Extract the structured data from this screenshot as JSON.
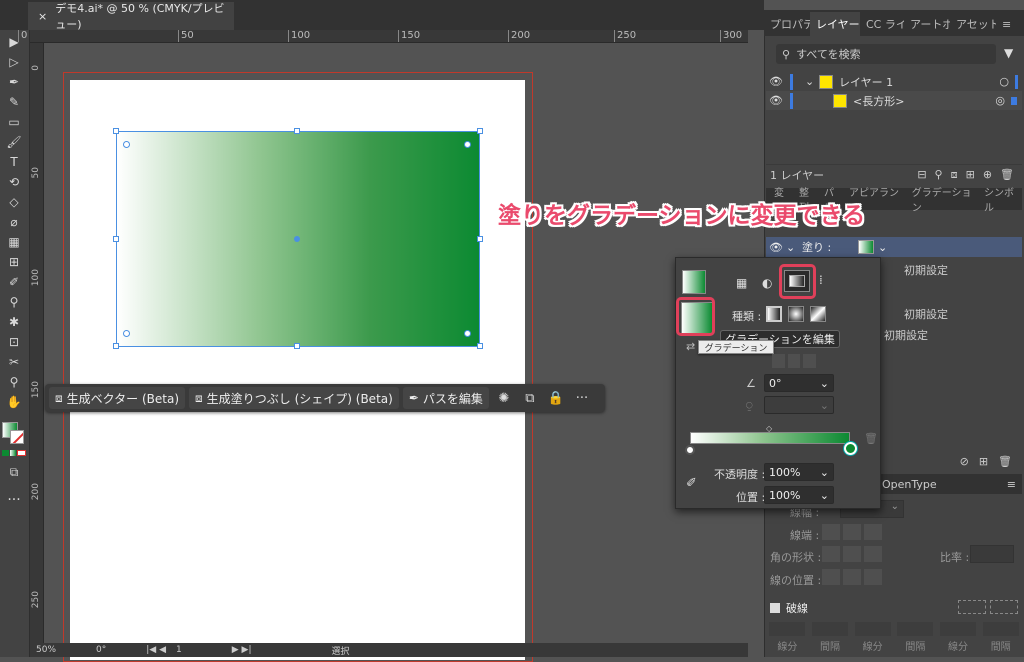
{
  "document": {
    "tab_title": "デモ4.ai* @ 50 % (CMYK/プレビュー)",
    "close_glyph": "×"
  },
  "ruler": {
    "h_ticks": [
      "0",
      "50",
      "100",
      "150",
      "200",
      "250",
      "300"
    ],
    "v_ticks": [
      "0",
      "50",
      "100",
      "150",
      "200",
      "250"
    ]
  },
  "context_bar": {
    "gen_vector": "生成ベクター (Beta)",
    "gen_fill": "生成塗りつぶし (シェイプ) (Beta)",
    "edit_path": "パスを編集"
  },
  "status_bar": {
    "zoom": "50%",
    "rotation": "0°",
    "artboard": "1",
    "tool": "選択"
  },
  "panel_tabs": [
    "プロパティ",
    "レイヤー",
    "CC ライブラリ",
    "アートボード",
    "アセット"
  ],
  "layers": {
    "search_placeholder": "すべてを検索",
    "layer1": "レイヤー 1",
    "rect": "<長方形>",
    "count": "1 レイヤー"
  },
  "annotation": "塗りをグラデーションに変更できる",
  "appearance": {
    "tabs": [
      "変形",
      "整列",
      "パス",
      "アピアランス",
      "グラデーション",
      "シンボル"
    ],
    "fill_label": "塗り :",
    "default1": "初期設定",
    "default2": "初期設定",
    "default3": "初期設定"
  },
  "stroke_panel": {
    "tab_opentype": "OpenType",
    "width_label": "線幅 :",
    "cap_label": "線端 :",
    "corner_label": "角の形状 :",
    "ratio_label": "比率 :",
    "align_label": "線の位置 :",
    "dash_label": "破線",
    "dash_cols": [
      "線分",
      "間隔",
      "線分",
      "間隔",
      "線分",
      "間隔"
    ]
  },
  "gradient_panel": {
    "type_label": "種類 :",
    "edit_button": "グラデーションを編集",
    "tooltip": "グラデーション",
    "angle_value": "0°",
    "opacity_label": "不透明度 :",
    "opacity_value": "100%",
    "location_label": "位置 :",
    "location_value": "100%"
  },
  "colors": {
    "accent_red": "#e0405a",
    "gradient_start": "#ffffff",
    "gradient_end": "#0c8a32",
    "selection_blue": "#4a90e2"
  }
}
